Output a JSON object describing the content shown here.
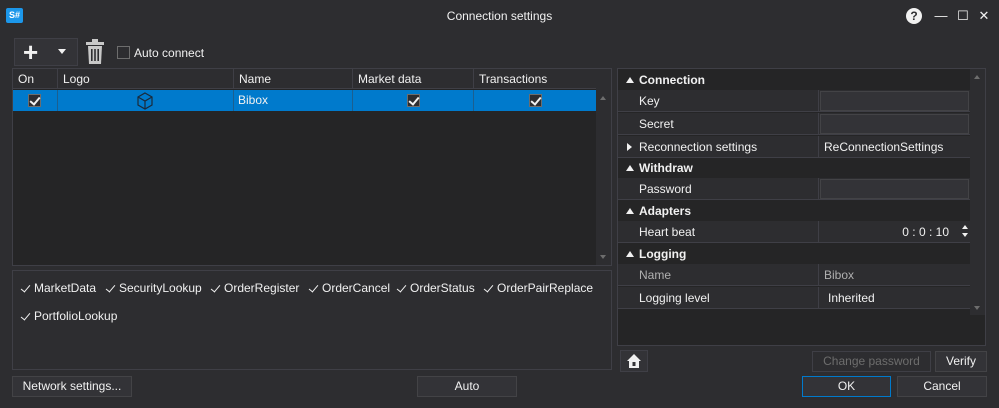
{
  "window": {
    "app_icon": "S#",
    "title": "Connection settings",
    "help": "?",
    "minimize": "—",
    "maximize": "☐",
    "close": "✕"
  },
  "toolbar": {
    "auto_connect_label": "Auto connect",
    "auto_connect_checked": false
  },
  "grid": {
    "columns": [
      "On",
      "Logo",
      "Name",
      "Market data",
      "Transactions"
    ],
    "rows": [
      {
        "on": true,
        "logo": "bibox-logo-icon",
        "name": "Bibox",
        "market_data": true,
        "transactions": true
      }
    ]
  },
  "capabilities": [
    "MarketData",
    "SecurityLookup",
    "OrderRegister",
    "OrderCancel",
    "OrderStatus",
    "OrderPairReplace",
    "PortfolioLookup"
  ],
  "properties": {
    "connection": {
      "label": "Connection",
      "key": "Key",
      "key_value": "",
      "secret": "Secret",
      "secret_value": "",
      "reconnection": "Reconnection settings",
      "reconnection_value": "ReConnectionSettings"
    },
    "withdraw": {
      "label": "Withdraw",
      "password": "Password",
      "password_value": ""
    },
    "adapters": {
      "label": "Adapters",
      "heartbeat": "Heart beat",
      "heartbeat_value": "0 : 0 : 10"
    },
    "logging": {
      "label": "Logging",
      "name": "Name",
      "name_value": "Bibox",
      "level": "Logging level",
      "level_value": "Inherited"
    }
  },
  "buttons": {
    "network_settings": "Network settings...",
    "auto": "Auto",
    "change_password": "Change password",
    "verify": "Verify",
    "ok": "OK",
    "cancel": "Cancel"
  },
  "colors": {
    "accent": "#007acc",
    "background": "#2d2d30",
    "panel": "#252526"
  }
}
